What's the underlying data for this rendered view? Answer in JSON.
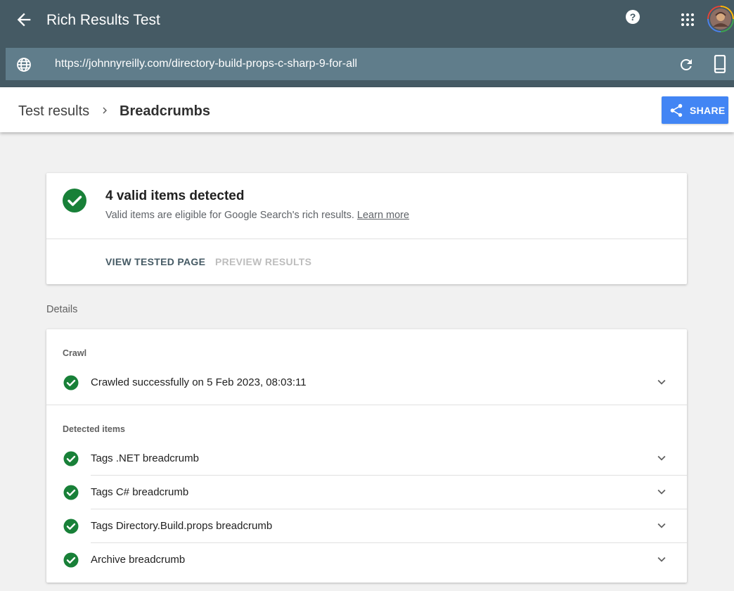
{
  "header": {
    "back_icon": "arrow-back-icon",
    "title": "Rich Results Test",
    "help_icon": "help-circle-icon",
    "apps_icon": "apps-grid-icon",
    "avatar_icon": "user-avatar"
  },
  "urlbar": {
    "globe_icon": "globe-icon",
    "url": "https://johnnyreilly.com/directory-build-props-c-sharp-9-for-all",
    "reload_icon": "refresh-icon",
    "device_icon": "smartphone-icon"
  },
  "breadcrumb": {
    "parent": "Test results",
    "current": "Breadcrumbs",
    "share_label": "SHARE"
  },
  "summary": {
    "title": "4 valid items detected",
    "subtitle": "Valid items are eligible for Google Search's rich results.",
    "learn_more": "Learn more",
    "tabs": [
      "VIEW TESTED PAGE",
      "PREVIEW RESULTS"
    ]
  },
  "details": {
    "label": "Details",
    "crawl_section": "Crawl",
    "crawl_status": "Crawled successfully on 5 Feb 2023, 08:03:11",
    "detected_section": "Detected items",
    "items": [
      "Tags .NET breadcrumb",
      "Tags C# breadcrumb",
      "Tags Directory.Build.props breadcrumb",
      "Archive breadcrumb"
    ]
  },
  "colors": {
    "header_bg": "#455a64",
    "urlbar_bg": "#607d8b",
    "accent_blue": "#4285f4",
    "success_green": "#188038"
  }
}
